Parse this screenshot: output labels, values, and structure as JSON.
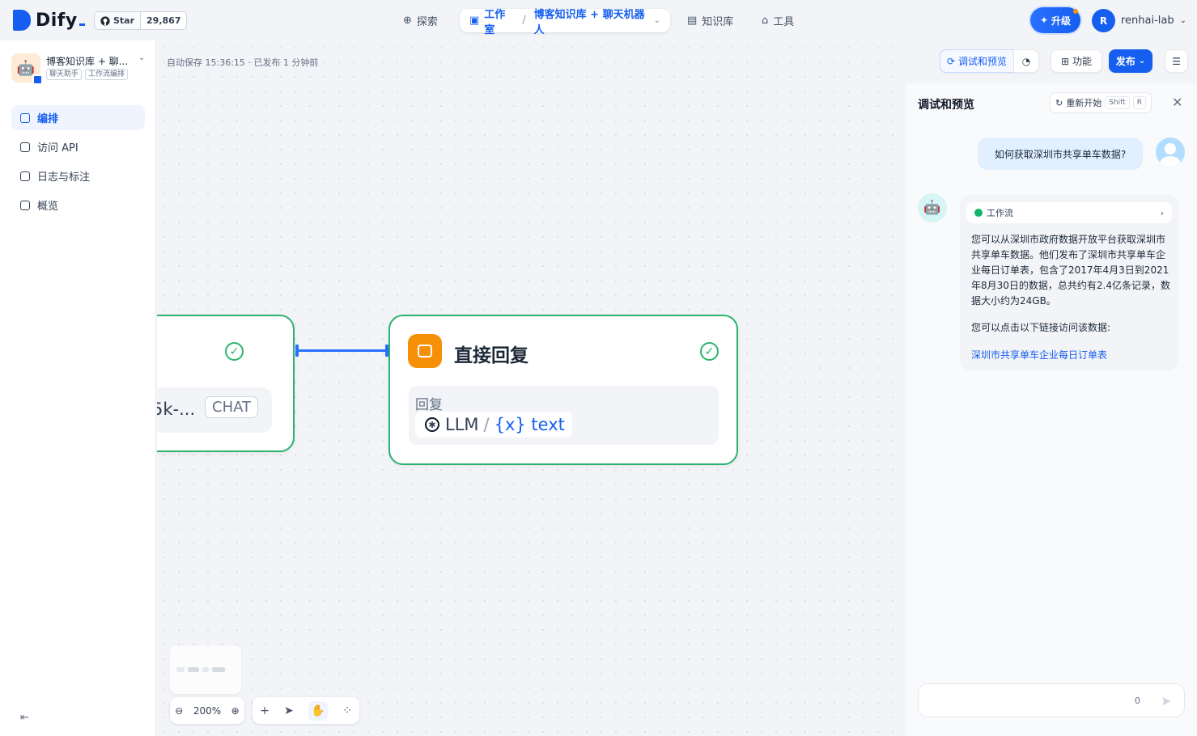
{
  "brand": {
    "name": "Dify",
    "github_star_label": "Star",
    "github_star_count": "29,867"
  },
  "nav": {
    "explore": "探索",
    "studio": "工作室",
    "app_path": "博客知识库 + 聊天机器人",
    "knowledge": "知识库",
    "tools": "工具"
  },
  "upgrade_label": "升级",
  "user": {
    "initial": "R",
    "name": "renhai-lab"
  },
  "app": {
    "name": "博客知识库 + 聊...",
    "tags": [
      "聊天助手",
      "工作流编排"
    ]
  },
  "sidebar": {
    "items": [
      {
        "label": "编排",
        "active": true
      },
      {
        "label": "访问 API",
        "active": false
      },
      {
        "label": "日志与标注",
        "active": false
      },
      {
        "label": "概览",
        "active": false
      }
    ]
  },
  "canvas": {
    "autosave": "自动保存 15:36:15 · 已发布 1 分钟前",
    "left_node": {
      "model": "5k-...",
      "mode_badge": "CHAT"
    },
    "reply_node": {
      "title": "直接回复",
      "field_label": "回复",
      "var_source": "LLM",
      "var_sep": "/",
      "var_name": "{x} text"
    },
    "zoom": "200%"
  },
  "header_buttons": {
    "debug": "调试和预览",
    "features": "功能",
    "publish": "发布"
  },
  "panel": {
    "title": "调试和预览",
    "restart": "重新开始",
    "restart_keys": [
      "Shift",
      "R"
    ],
    "question": "如何获取深圳市共享单车数据?",
    "workflow_label": "工作流",
    "answer_p1": "您可以从深圳市政府数据开放平台获取深圳市共享单车数据。他们发布了深圳市共享单车企业每日订单表，包含了2017年4月3日到2021年8月30日的数据，总共约有2.4亿条记录，数据大小约为24GB。",
    "answer_p2": "您可以点击以下链接访问该数据:",
    "answer_link": "深圳市共享单车企业每日订单表",
    "input_count": "0"
  },
  "colors": {
    "accent": "#155eef",
    "success": "#2bb36e",
    "reply_icon": "#f79009"
  },
  "icons": [
    "github-icon",
    "explore-icon",
    "studio-icon",
    "knowledge-icon",
    "tools-icon",
    "shield-icon",
    "chevron-down-icon",
    "edit-icon",
    "api-icon",
    "log-icon",
    "chart-icon",
    "collapse-icon",
    "check-circle-icon",
    "reply-icon",
    "llm-icon",
    "zoom-out-icon",
    "zoom-in-icon",
    "plus-icon",
    "pointer-icon",
    "hand-icon",
    "layout-icon",
    "history-icon",
    "grid-icon",
    "checklist-icon",
    "refresh-icon",
    "close-icon",
    "bot-icon",
    "send-icon"
  ]
}
